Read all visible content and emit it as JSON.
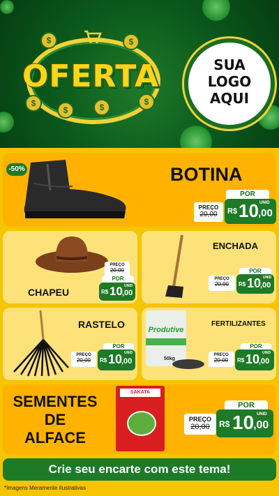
{
  "header": {
    "title": "OFERTA",
    "logo_lines": [
      "SUA",
      "LOGO",
      "AQUI"
    ]
  },
  "currency": "R$",
  "unit_label": "UNID",
  "por_label": "POR",
  "preco_label": "PREÇO",
  "products": [
    {
      "name": "BOTINA",
      "badge": "-50%",
      "old_price": "20,00",
      "price_int": "10",
      "price_dec": ",00"
    },
    {
      "name": "CHAPEU",
      "old_price": "20,00",
      "price_int": "10",
      "price_dec": ",00"
    },
    {
      "name": "ENCHADA",
      "old_price": "20,00",
      "price_int": "10",
      "price_dec": ",00"
    },
    {
      "name": "RASTELO",
      "old_price": "20,00",
      "price_int": "10",
      "price_dec": ",00"
    },
    {
      "name": "FERTILIZANTES",
      "old_price": "20,00",
      "price_int": "10",
      "price_dec": ",00",
      "bag_brand": "Produtive",
      "bag_weight": "50kg"
    },
    {
      "name_lines": [
        "SEMENTES",
        "DE",
        "ALFACE"
      ],
      "old_price": "20,00",
      "price_int": "10",
      "price_dec": ",00",
      "pack_brand": "SAKATA"
    }
  ],
  "footer": {
    "cta": "Crie seu encarte com este tema!",
    "disclaimer": "*Imagens Meramente Ilustrativas"
  },
  "colors": {
    "green": "#1d7a27",
    "yellow": "#ffcf00",
    "orange": "#ffb300"
  }
}
